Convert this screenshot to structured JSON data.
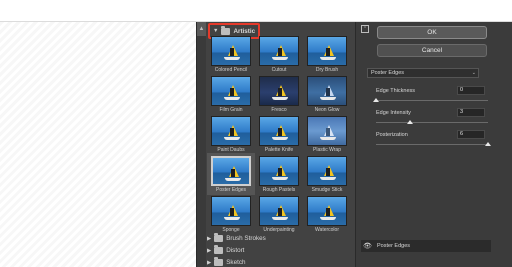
{
  "gallery": {
    "open_category": "Artistic",
    "filters": [
      {
        "name": "Colored Pencil"
      },
      {
        "name": "Cutout"
      },
      {
        "name": "Dry Brush"
      },
      {
        "name": "Film Grain"
      },
      {
        "name": "Fresco"
      },
      {
        "name": "Neon Glow"
      },
      {
        "name": "Paint Daubs"
      },
      {
        "name": "Palette Knife"
      },
      {
        "name": "Plastic Wrap"
      },
      {
        "name": "Poster Edges",
        "selected": true
      },
      {
        "name": "Rough Pastels"
      },
      {
        "name": "Smudge Stick"
      },
      {
        "name": "Sponge"
      },
      {
        "name": "Underpainting"
      },
      {
        "name": "Watercolor"
      }
    ],
    "other_categories": [
      "Brush Strokes",
      "Distort",
      "Sketch"
    ]
  },
  "settings": {
    "ok_label": "OK",
    "cancel_label": "Cancel",
    "selected_filter": "Poster Edges",
    "params": [
      {
        "label": "Edge Thickness",
        "value": "0",
        "fraction": 0.0
      },
      {
        "label": "Edge Intensity",
        "value": "3",
        "fraction": 0.3
      },
      {
        "label": "Posterization",
        "value": "6",
        "fraction": 1.0
      }
    ],
    "effect_layer": "Poster Edges"
  },
  "colors": {
    "panel_bg": "#424242",
    "settings_bg": "#3b3b3b",
    "highlight_border": "#e53a2b",
    "thumb_sail": "#f2c421"
  }
}
